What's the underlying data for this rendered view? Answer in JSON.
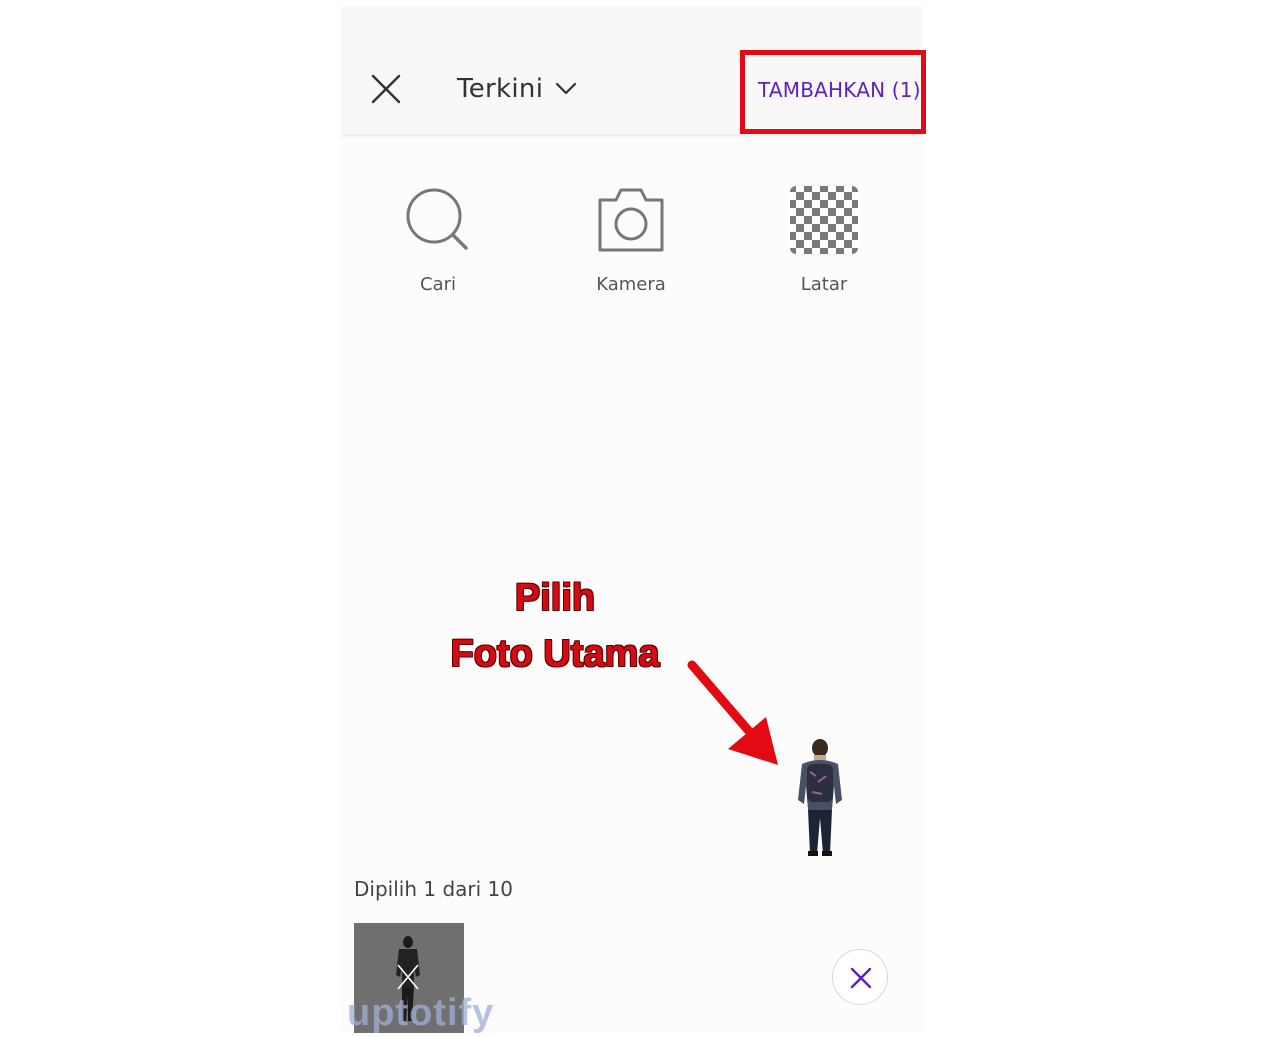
{
  "header": {
    "folder_label": "Terkini",
    "add_button_label": "TAMBAHKAN (1)"
  },
  "tools": [
    {
      "label": "Cari",
      "icon": "search-icon"
    },
    {
      "label": "Kamera",
      "icon": "camera-icon"
    },
    {
      "label": "Latar",
      "icon": "transparent-background-icon"
    }
  ],
  "annotation": {
    "line1": "Pilih",
    "line2": "Foto Utama",
    "color": "#d40b12"
  },
  "selection": {
    "label": "Dipilih 1 dari 10"
  },
  "watermark": "uptotify",
  "colors": {
    "accent": "#5c1fc4",
    "highlight": "#e30b13"
  }
}
